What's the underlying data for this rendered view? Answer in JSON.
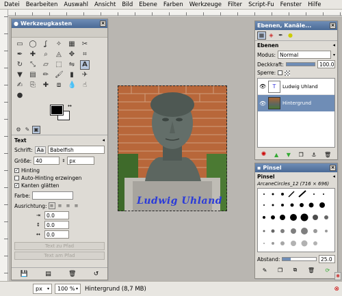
{
  "menu": [
    "Datei",
    "Bearbeiten",
    "Auswahl",
    "Ansicht",
    "Bild",
    "Ebene",
    "Farben",
    "Werkzeuge",
    "Filter",
    "Script-Fu",
    "Fenster",
    "Hilfe"
  ],
  "toolbox": {
    "title": "Werkzeugkasten",
    "tool_options_title": "Text",
    "font_label": "Schrift:",
    "font_value": "Babelfish",
    "size_label": "Größe:",
    "size_value": "40",
    "unit_value": "px",
    "hinting_label": "Hinting",
    "autohint_label": "Auto-Hinting erzwingen",
    "antialias_label": "Kanten glätten",
    "color_label": "Farbe:",
    "justify_label": "Ausrichtung:",
    "indent_value": "0.0",
    "line_spacing_value": "0.0",
    "letter_spacing_value": "0.0",
    "text_path_label": "Text zu Pfad",
    "text_along_path_label": "Text am Pfad"
  },
  "layers": {
    "title": "Ebenen, Kanäle...",
    "heading": "Ebenen",
    "mode_label": "Modus:",
    "mode_value": "Normal",
    "opacity_label": "Deckkraft:",
    "opacity_value": "100.0",
    "lock_label": "Sperre:",
    "layer_text_name": "Ludwig Uhland",
    "layer_bg_name": "Hintergrund"
  },
  "brushes": {
    "title": "Pinsel",
    "heading": "Pinsel",
    "brush_name": "ArcaneCircles_12 (716 × 696)",
    "spacing_label": "Abstand:",
    "spacing_value": "25.0"
  },
  "image": {
    "text_layer": "Ludwig Uhland"
  },
  "status": {
    "unit": "px",
    "zoom": "100 %",
    "message": "Hintergrund (8,7 MB)"
  }
}
